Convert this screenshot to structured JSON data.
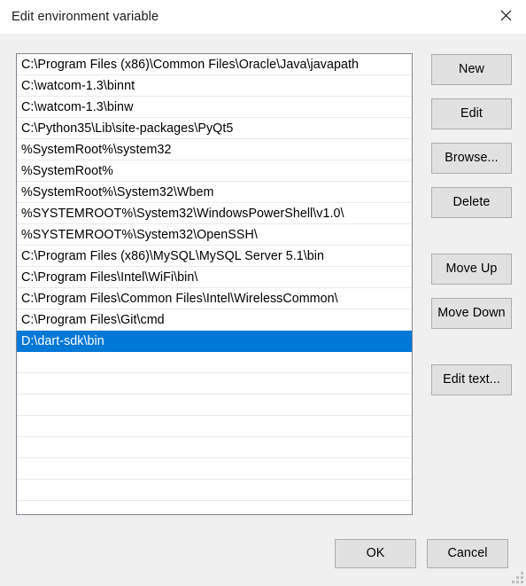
{
  "window": {
    "title": "Edit environment variable",
    "close_icon": "close-icon",
    "accent_color": "#0078d7",
    "background_color": "#f0f0f0",
    "titlebar_color": "#ffffff",
    "listbox_background": "#ffffff",
    "listbox_border_color": "#828790",
    "button_face_color": "#e1e1e1",
    "button_border_color": "#adadad",
    "text_color": "#000000",
    "selected_text_color": "#ffffff"
  },
  "path_list": {
    "selected_index": 13,
    "visible_empty_rows": 7,
    "entries": [
      "C:\\Program Files (x86)\\Common Files\\Oracle\\Java\\javapath",
      "C:\\watcom-1.3\\binnt",
      "C:\\watcom-1.3\\binw",
      "C:\\Python35\\Lib\\site-packages\\PyQt5",
      "%SystemRoot%\\system32",
      "%SystemRoot%",
      "%SystemRoot%\\System32\\Wbem",
      "%SYSTEMROOT%\\System32\\WindowsPowerShell\\v1.0\\",
      "%SYSTEMROOT%\\System32\\OpenSSH\\",
      "C:\\Program Files (x86)\\MySQL\\MySQL Server 5.1\\bin",
      "C:\\Program Files\\Intel\\WiFi\\bin\\",
      "C:\\Program Files\\Common Files\\Intel\\WirelessCommon\\",
      "C:\\Program Files\\Git\\cmd",
      "D:\\dart-sdk\\bin"
    ]
  },
  "side_buttons": {
    "new": "New",
    "edit": "Edit",
    "browse": "Browse...",
    "delete": "Delete",
    "move_up": "Move Up",
    "move_down": "Move Down",
    "edit_text": "Edit text..."
  },
  "bottom_buttons": {
    "ok": "OK",
    "cancel": "Cancel"
  },
  "resize_grip": {
    "icon": "resize-grip-icon"
  }
}
